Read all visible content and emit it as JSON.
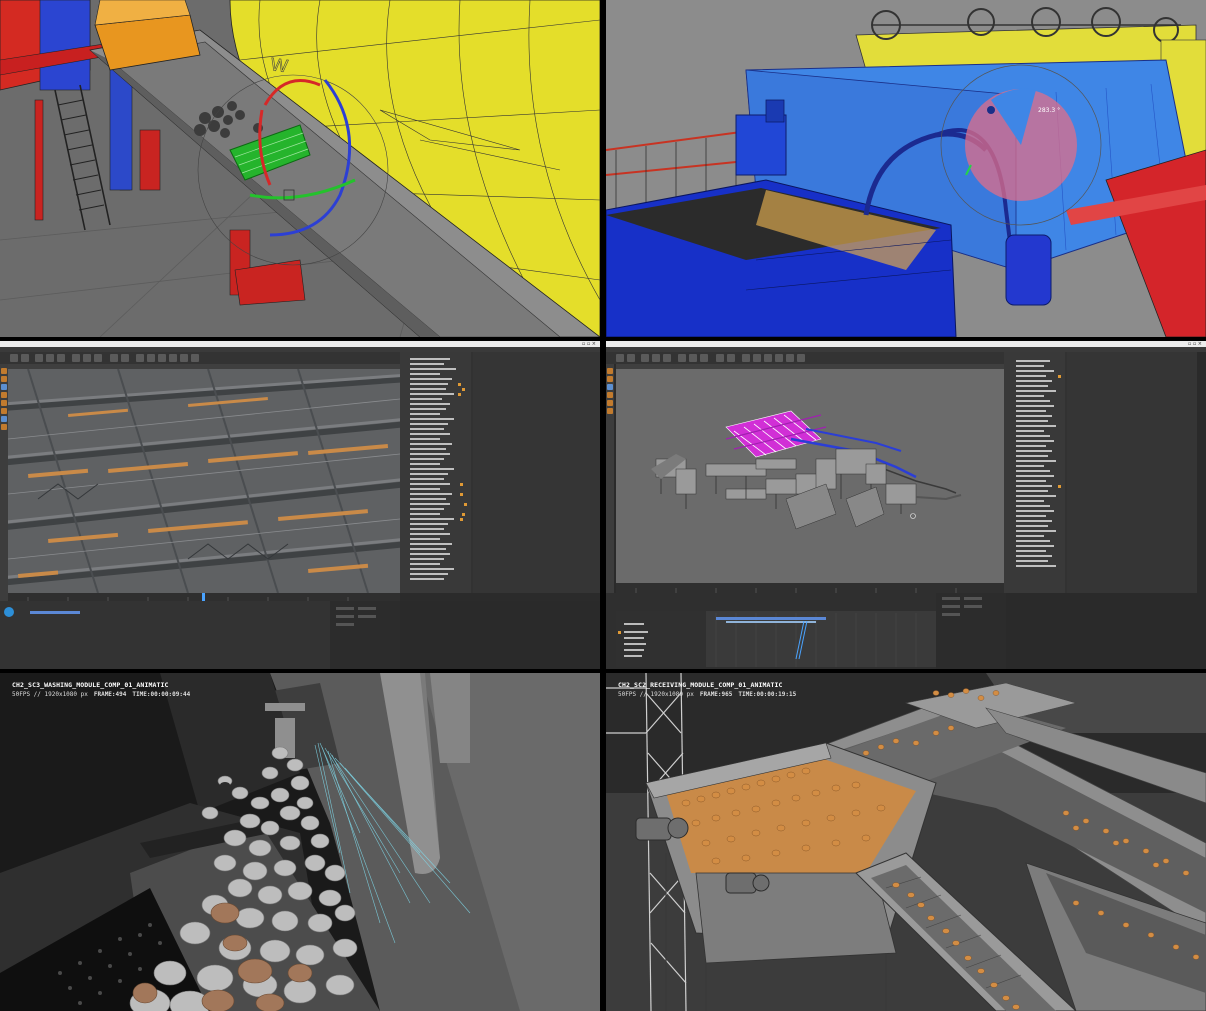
{
  "panels": {
    "washing": {
      "title": "CH2_SC3_WASHING_MODULE_COMP_01_ANIMATIC",
      "specs": "50FPS // 1920x1080 px",
      "frame_label": "FRAME:",
      "frame": "494",
      "time_label": "TIME:",
      "time": "00:00:09:44"
    },
    "receiving": {
      "title": "CH2_SC2_RECEIVING_MODULE_COMP_01_ANIMATIC",
      "specs": "50FPS // 1920x1080 px",
      "frame_label": "FRAME:",
      "frame": "965",
      "time_label": "TIME:",
      "time": "00:00:19:15"
    },
    "viewport_top_right": {
      "angle_readout": "283.3 °"
    }
  },
  "colors": {
    "c4d_accent": "#c27b2e",
    "hud_text": "#ffffff",
    "machine_yellow": "#e4de2a",
    "machine_blue": "#3f86e6",
    "machine_red": "#d42a22",
    "potato": "#c98a48",
    "selection_magenta": "#d12fd6"
  }
}
